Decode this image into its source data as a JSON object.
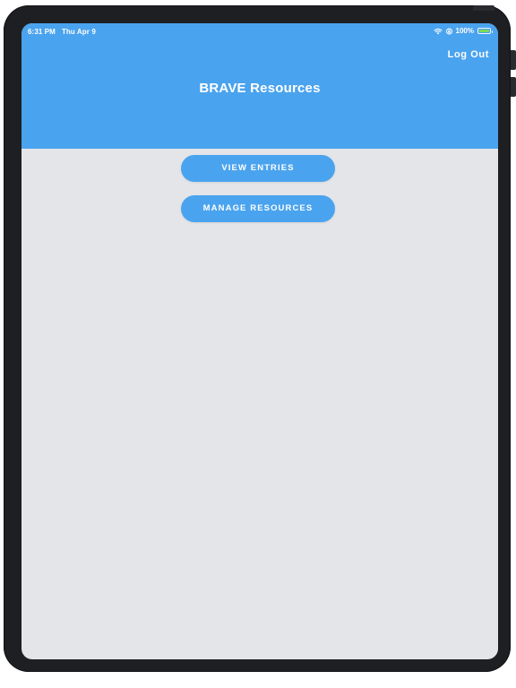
{
  "status_bar": {
    "time": "6:31 PM",
    "date": "Thu Apr 9",
    "battery_percent": "100%",
    "battery_level": 1.0,
    "battery_color": "#7ed957",
    "icons": [
      "wifi-icon",
      "orientation-lock-icon",
      "battery-icon"
    ]
  },
  "header": {
    "title": "BRAVE Resources",
    "logout_label": "Log Out",
    "background_color": "#4aa3ee"
  },
  "actions": {
    "view_entries_label": "VIEW ENTRIES",
    "manage_resources_label": "MANAGE RESOURCES",
    "button_color": "#4aa3ee"
  },
  "screen": {
    "background_color": "#e3e5e8"
  }
}
